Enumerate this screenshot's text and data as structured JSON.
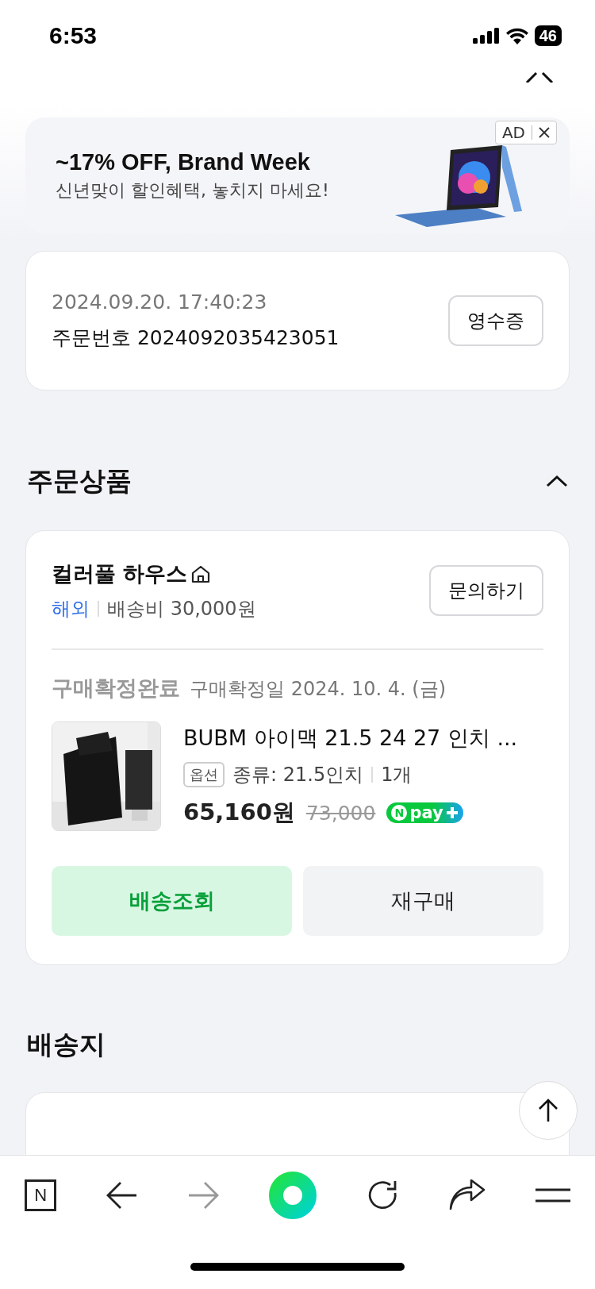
{
  "status_bar": {
    "time": "6:53",
    "battery": "46"
  },
  "ad": {
    "title": "~17% OFF, Brand Week",
    "subtitle": "신년맞이 할인혜택, 놓치지 마세요!",
    "badge": "AD"
  },
  "order": {
    "datetime": "2024.09.20. 17:40:23",
    "number": "주문번호 2024092035423051",
    "receipt_button": "영수증"
  },
  "section_products": {
    "title": "주문상품",
    "expanded": true
  },
  "store": {
    "name": "컬러풀 하우스",
    "region": "해외",
    "shipping": "배송비 30,000원",
    "inquiry_button": "문의하기"
  },
  "item": {
    "status": "구매확정완료",
    "confirm_date": "구매확정일 2024. 10. 4. (금)",
    "name": "BUBM 아이맥 21.5 24 27 인치 ...",
    "option_tag": "옵션",
    "option": "종류: 21.5인치",
    "quantity": "1개",
    "price": "65,160원",
    "original_price": "73,000",
    "npay": {
      "n": "N",
      "pay": "pay"
    }
  },
  "actions": [
    {
      "label": "배송조회",
      "kind": "primary"
    },
    {
      "label": "재구매",
      "kind": "secondary"
    }
  ],
  "section_address": {
    "title": "배송지"
  },
  "browser_bar": {
    "home": "N",
    "forward_disabled": true
  }
}
